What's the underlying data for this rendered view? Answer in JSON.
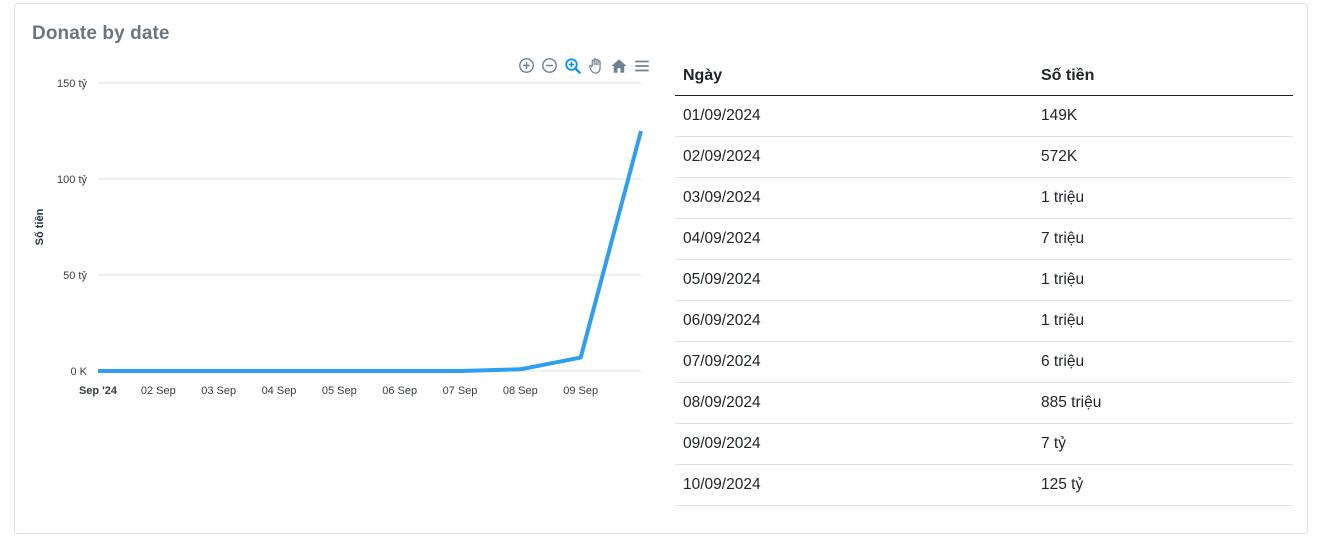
{
  "card": {
    "title": "Donate by date"
  },
  "toolbar": {
    "icons": [
      "zoom-in-icon",
      "zoom-out-icon",
      "selection-zoom-icon",
      "pan-hand-icon",
      "home-reset-icon",
      "menu-icon"
    ],
    "active_color": "#008ffb",
    "inactive_color": "#6e8192"
  },
  "chart_data": {
    "type": "line",
    "title": "",
    "xlabel": "",
    "ylabel": "Số tiền",
    "x": [
      "Sep '24",
      "02 Sep",
      "03 Sep",
      "04 Sep",
      "05 Sep",
      "06 Sep",
      "07 Sep",
      "08 Sep",
      "09 Sep",
      "10 Sep"
    ],
    "x_tick_labels": [
      "Sep '24",
      "02 Sep",
      "03 Sep",
      "04 Sep",
      "05 Sep",
      "06 Sep",
      "07 Sep",
      "08 Sep",
      "09 Sep"
    ],
    "y_ticks": [
      0,
      50,
      100,
      150
    ],
    "y_tick_labels": [
      "0 K",
      "50 tỷ",
      "100 tỷ",
      "150 tỷ"
    ],
    "ylim": [
      0,
      150
    ],
    "y_unit": "tỷ",
    "series": [
      {
        "values": [
          0.000149,
          0.000572,
          0.001,
          0.007,
          0.001,
          0.001,
          0.006,
          0.885,
          7,
          125
        ],
        "color": "#2e9ff0"
      }
    ],
    "grid": true,
    "legend": "none"
  },
  "table": {
    "headers": [
      "Ngày",
      "Số tiền"
    ],
    "rows": [
      [
        "01/09/2024",
        "149K"
      ],
      [
        "02/09/2024",
        "572K"
      ],
      [
        "03/09/2024",
        "1 triệu"
      ],
      [
        "04/09/2024",
        "7 triệu"
      ],
      [
        "05/09/2024",
        "1 triệu"
      ],
      [
        "06/09/2024",
        "1 triệu"
      ],
      [
        "07/09/2024",
        "6 triệu"
      ],
      [
        "08/09/2024",
        "885 triệu"
      ],
      [
        "09/09/2024",
        "7 tỷ"
      ],
      [
        "10/09/2024",
        "125 tỷ"
      ]
    ]
  }
}
